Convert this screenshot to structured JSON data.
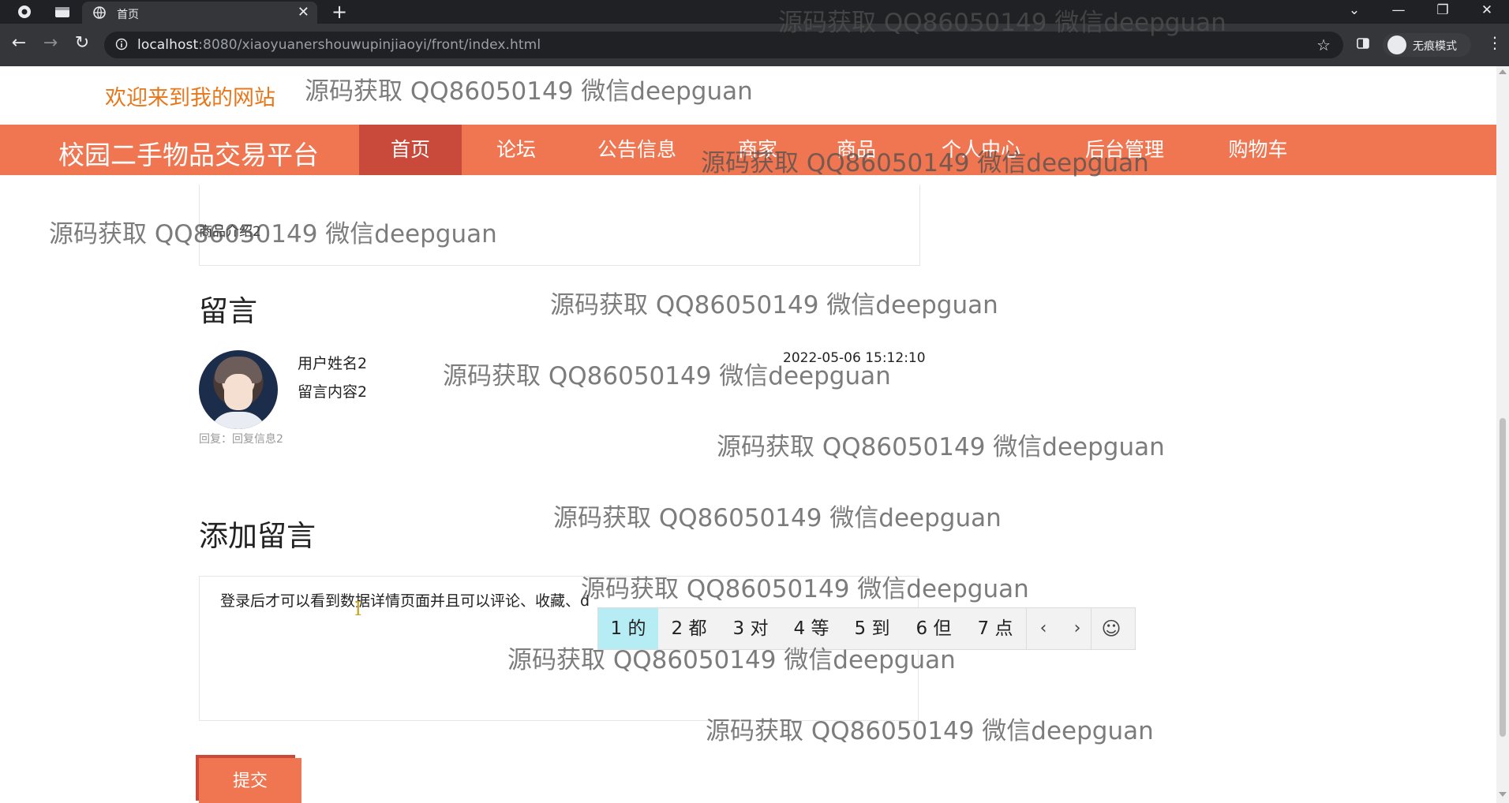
{
  "browser": {
    "tab_title": "首页",
    "url_host": "localhost",
    "url_path": ":8080/xiaoyuanershouwupinjiaoyi/front/index.html",
    "incognito_label": "无痕模式"
  },
  "site": {
    "welcome": "欢迎来到我的网站",
    "brand": "校园二手物品交易平台",
    "nav": [
      "首页",
      "论坛",
      "公告信息",
      "商家",
      "商品",
      "个人中心",
      "后台管理",
      "购物车"
    ]
  },
  "product": {
    "intro": "商品介绍2"
  },
  "comments": {
    "title": "留言",
    "items": [
      {
        "user": "用户姓名2",
        "content": "留言内容2",
        "time": "2022-05-06 15:12:10",
        "reply": "回复：回复信息2"
      }
    ]
  },
  "add_comment": {
    "title": "添加留言",
    "input_value": "登录后才可以看到数据详情页面并且可以评论、收藏、d",
    "submit_label": "提交"
  },
  "ime": {
    "candidates": [
      "1 的",
      "2 都",
      "3 对",
      "4 等",
      "5 到",
      "6 但",
      "7 点"
    ]
  },
  "watermark": "源码获取 QQ86050149 微信deepguan",
  "colors": {
    "accent": "#f07652",
    "accent_dark": "#c94a3a",
    "welcome": "#e8771a"
  }
}
